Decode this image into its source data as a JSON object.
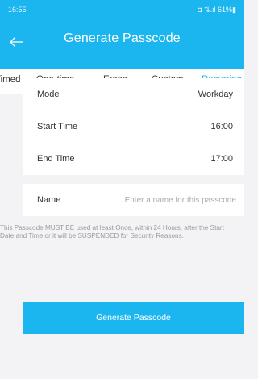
{
  "status_bar": {
    "time": "16:55",
    "icons": "◘ ⇅.ıl 61%▮"
  },
  "header": {
    "title": "Generate Passcode",
    "back_icon": "arrow-left-icon"
  },
  "tabs": [
    {
      "label": "Timed",
      "active": false
    },
    {
      "label": "One-time",
      "active": false
    },
    {
      "label": "Erase",
      "active": false
    },
    {
      "label": "Custom",
      "active": false
    },
    {
      "label": "Recurring",
      "active": true
    }
  ],
  "form": {
    "mode": {
      "label": "Mode",
      "value": "Workday"
    },
    "start_time": {
      "label": "Start Time",
      "value": "16:00"
    },
    "end_time": {
      "label": "End Time",
      "value": "17:00"
    },
    "name": {
      "label": "Name",
      "placeholder": "Enter a name for this passcode",
      "value": ""
    }
  },
  "notice": "This Passcode MUST BE used at least Once, within 24 Hours, after the Start Date and Time or it will be SUSPENDED for Security Reasons.",
  "generate_button": {
    "label": "Generate Passcode"
  },
  "colors": {
    "accent": "#1bb6ef",
    "background": "#f3f3f5",
    "text": "#333333",
    "muted": "#9a9a9a"
  }
}
